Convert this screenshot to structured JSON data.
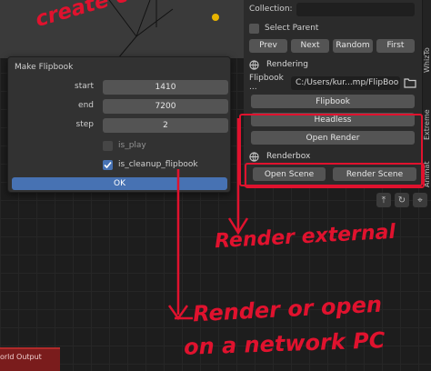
{
  "panel": {
    "collection_label": "Collection:",
    "select_parent_label": "Select Parent",
    "nav_buttons": [
      "Prev",
      "Next",
      "Random",
      "First"
    ],
    "rendering_title": "Rendering",
    "flipbook_label": "Flipbook ...",
    "flipbook_path": "C:/Users/kur...mp/FlipBooks",
    "flipbook_button": "Flipbook",
    "headless_button": "Headless",
    "open_render_button": "Open Render",
    "renderbox_title": "Renderbox",
    "open_scene_button": "Open Scene",
    "render_scene_button": "Render Scene"
  },
  "tabs": [
    "WhizTo",
    "Extreme",
    "Animat"
  ],
  "dialog": {
    "title": "Make Flipbook",
    "fields": [
      {
        "label": "start",
        "value": "1410"
      },
      {
        "label": "end",
        "value": "7200"
      },
      {
        "label": "step",
        "value": "2"
      }
    ],
    "is_play_label": "is_play",
    "is_play_checked": false,
    "cleanup_label": "is_cleanup_flipbook",
    "cleanup_checked": true,
    "ok_label": "OK"
  },
  "node": {
    "world_output_label": "orld Output"
  },
  "annotations": {
    "top": "create custom flips",
    "middle": "Render external",
    "bottom_line1": "Render or open",
    "bottom_line2": "on a network PC"
  },
  "colors": {
    "annotation": "#e0122e",
    "ok_button": "#4772b3",
    "world_output_node": "#7a1c1c"
  },
  "icons": [
    "globe-icon",
    "folder-icon",
    "node-up-icon",
    "loop-icon",
    "pin-icon"
  ]
}
